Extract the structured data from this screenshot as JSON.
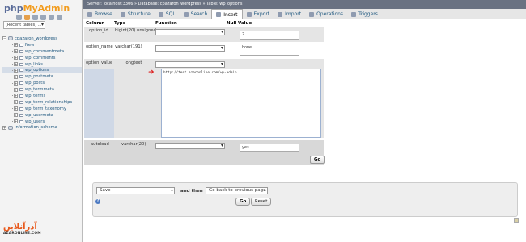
{
  "app": {
    "logo_php": "php",
    "logo_myadmin": "MyAdmin"
  },
  "nav": {
    "recent_tables": "(Recent tables) ...",
    "tree": [
      {
        "label": "cpazaron_wordpress",
        "kind": "db",
        "toggle": "−"
      },
      {
        "label": "New",
        "kind": "new"
      },
      {
        "label": "wp_commentmeta",
        "kind": "table"
      },
      {
        "label": "wp_comments",
        "kind": "table"
      },
      {
        "label": "wp_links",
        "kind": "table"
      },
      {
        "label": "wp_options",
        "kind": "table",
        "active": true
      },
      {
        "label": "wp_postmeta",
        "kind": "table"
      },
      {
        "label": "wp_posts",
        "kind": "table"
      },
      {
        "label": "wp_termmeta",
        "kind": "table"
      },
      {
        "label": "wp_terms",
        "kind": "table"
      },
      {
        "label": "wp_term_relationships",
        "kind": "table"
      },
      {
        "label": "wp_term_taxonomy",
        "kind": "table"
      },
      {
        "label": "wp_usermeta",
        "kind": "table"
      },
      {
        "label": "wp_users",
        "kind": "table"
      },
      {
        "label": "information_schema",
        "kind": "db",
        "toggle": "+"
      }
    ]
  },
  "breadcrumb": "Server: localhost:3306 » Database: cpazaron_wordpress » Table: wp_options",
  "tabs": [
    {
      "label": "Browse"
    },
    {
      "label": "Structure"
    },
    {
      "label": "SQL"
    },
    {
      "label": "Search"
    },
    {
      "label": "Insert",
      "active": true
    },
    {
      "label": "Export"
    },
    {
      "label": "Import"
    },
    {
      "label": "Operations"
    },
    {
      "label": "Triggers"
    }
  ],
  "table": {
    "headers": {
      "column": "Column",
      "type": "Type",
      "function": "Function",
      "null": "Null",
      "value": "Value"
    },
    "rows": {
      "option_id": {
        "column": "option_id",
        "type": "bigint(20) unsigned",
        "value": "2"
      },
      "option_name": {
        "column": "option_name",
        "type": "varchar(191)",
        "value": "home"
      },
      "option_value": {
        "column": "option_value",
        "type": "longtext",
        "value": "http://test.azaronline.com/wp-admin"
      },
      "autoload": {
        "column": "autoload",
        "type": "varchar(20)",
        "value": "yes"
      }
    },
    "go_label": "Go"
  },
  "options": {
    "action_select": "Save",
    "and_then": "and then",
    "after_select": "Go back to previous page",
    "go_label": "Go",
    "reset_label": "Reset"
  },
  "watermark": {
    "name": "آذرآنلاین",
    "sub": "AZARONLINE.COM"
  },
  "colors": {
    "accent_orange": "#f29c1e",
    "link_blue": "#235a81",
    "arrow_red": "#dd2222"
  }
}
